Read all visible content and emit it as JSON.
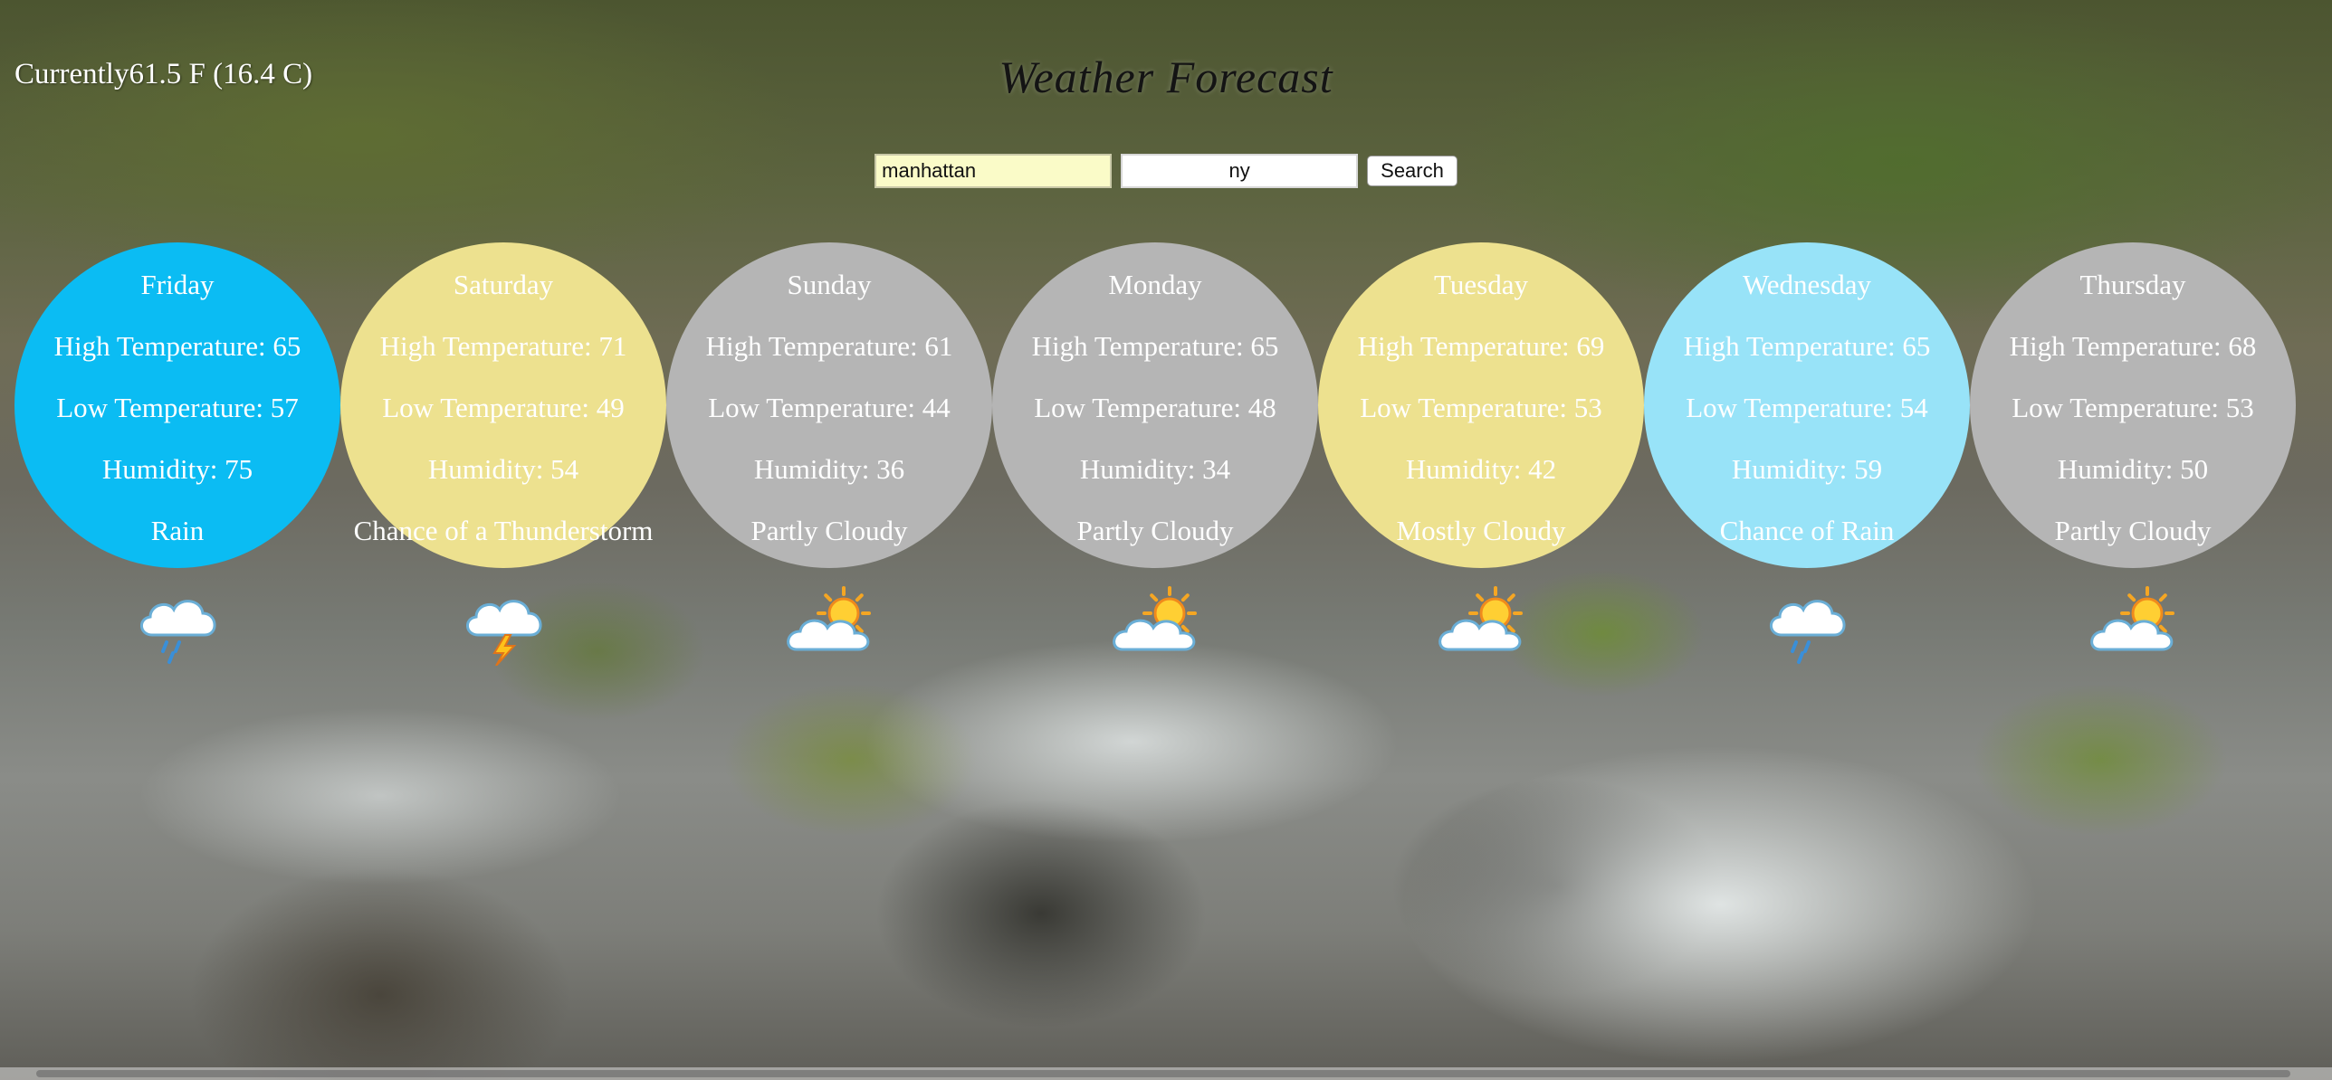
{
  "current": {
    "text": "Currently61.5 F (16.4 C)"
  },
  "title": "Weather Forecast",
  "search": {
    "city_value": "manhattan",
    "state_value": "ny",
    "button_label": "Search"
  },
  "forecast": [
    {
      "day": "Friday",
      "high": "High Temperature: 65",
      "low": "Low Temperature: 57",
      "humidity": "Humidity: 75",
      "condition": "Rain",
      "color": "#0bbcf3",
      "icon": "rain-cloud-icon"
    },
    {
      "day": "Saturday",
      "high": "High Temperature: 71",
      "low": "Low Temperature: 49",
      "humidity": "Humidity: 54",
      "condition": "Chance of a Thunderstorm",
      "color": "#ede18f",
      "icon": "thunderstorm-icon"
    },
    {
      "day": "Sunday",
      "high": "High Temperature: 61",
      "low": "Low Temperature: 44",
      "humidity": "Humidity: 36",
      "condition": "Partly Cloudy",
      "color": "#b5b5b5",
      "icon": "partly-cloudy-icon"
    },
    {
      "day": "Monday",
      "high": "High Temperature: 65",
      "low": "Low Temperature: 48",
      "humidity": "Humidity: 34",
      "condition": "Partly Cloudy",
      "color": "#b5b5b5",
      "icon": "partly-cloudy-icon"
    },
    {
      "day": "Tuesday",
      "high": "High Temperature: 69",
      "low": "Low Temperature: 53",
      "humidity": "Humidity: 42",
      "condition": "Mostly Cloudy",
      "color": "#ede18f",
      "icon": "partly-cloudy-icon"
    },
    {
      "day": "Wednesday",
      "high": "High Temperature: 65",
      "low": "Low Temperature: 54",
      "humidity": "Humidity: 59",
      "condition": "Chance of Rain",
      "color": "#98e3f8",
      "icon": "rain-cloud-icon"
    },
    {
      "day": "Thursday",
      "high": "High Temperature: 68",
      "low": "Low Temperature: 53",
      "humidity": "Humidity: 50",
      "condition": "Partly Cloudy",
      "color": "#b5b5b5",
      "icon": "partly-cloudy-icon"
    }
  ]
}
